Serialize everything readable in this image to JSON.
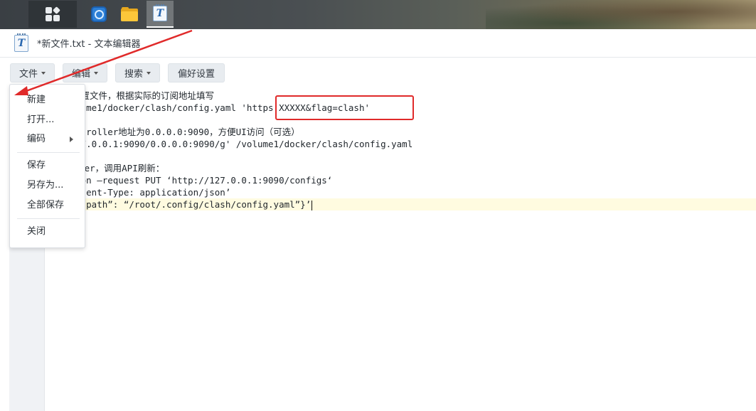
{
  "window": {
    "title": "*新文件.txt - 文本编辑器"
  },
  "taskbar": {
    "items": [
      "main-menu",
      "package-center",
      "file-station",
      "text-editor"
    ]
  },
  "toolbar": {
    "file_label": "文件",
    "edit_label": "编辑",
    "search_label": "搜索",
    "prefs_label": "偏好设置"
  },
  "file_menu": {
    "items": [
      "新建",
      "打开...",
      "编码",
      "保存",
      "另存为...",
      "全部保存",
      "关闭"
    ]
  },
  "editor": {
    "lines": [
      "节点配置文件，根据实际的订阅地址填写",
      " /volume1/docker/clash/config.yaml 'https:XXXXX&flag=clash'",
      "",
      "l-controller地址为0.0.0.0:9090，方便UI访问（可选）",
      "'s/127.0.0.1:9090/0.0.0.0:9090/g' /volume1/docker/clash/config.yaml",
      "",
      "启Docker，调用API刷新：",
      "ocation –request PUT ‘http://127.0.0.1:9090/configs‘",
      " ‘Content-Type: application/json’",
      "aw ‘{“path”: “/root/.config/clash/config.yaml”}’"
    ]
  },
  "colors": {
    "highlight": "#e02a2a",
    "accent": "#2c7fd6"
  }
}
